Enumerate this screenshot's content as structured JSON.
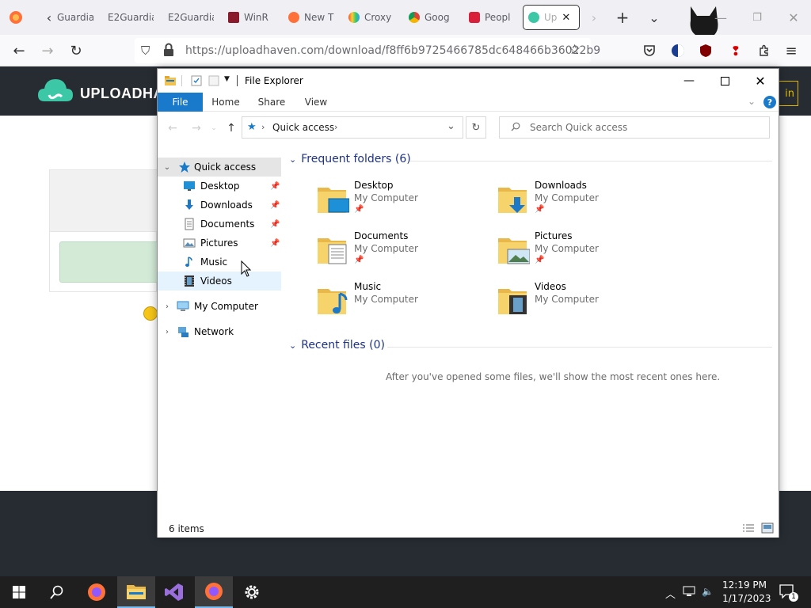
{
  "browser": {
    "tabs": [
      {
        "label": "Guardia",
        "icon": "chevron-left-icon"
      },
      {
        "label": "E2Guardia"
      },
      {
        "label": "E2Guardia"
      },
      {
        "label": "WinR",
        "icon": "winrar-icon"
      },
      {
        "label": "New T",
        "icon": "firefox-icon"
      },
      {
        "label": "Croxy",
        "icon": "rainbow-icon"
      },
      {
        "label": "Goog",
        "icon": "chrome-icon"
      },
      {
        "label": "Peopl",
        "icon": "lock-red-icon"
      },
      {
        "label": "Up",
        "icon": "uploadhaven-icon",
        "active": true
      }
    ],
    "url_host": "https://uploadhaven.com",
    "url_path": "/download/f8ff6b9725466785dc648466b36022b9"
  },
  "page": {
    "logo_text": "UPLOADHAVEN",
    "signin_peek": "in"
  },
  "explorer": {
    "title": "File Explorer",
    "ribbon_tabs": [
      "File",
      "Home",
      "Share",
      "View"
    ],
    "address": "Quick access",
    "search_placeholder": "Search Quick access",
    "nav": {
      "quick_access": "Quick access",
      "items": [
        {
          "label": "Desktop",
          "pinned": true
        },
        {
          "label": "Downloads",
          "pinned": true
        },
        {
          "label": "Documents",
          "pinned": true
        },
        {
          "label": "Pictures",
          "pinned": true
        },
        {
          "label": "Music",
          "pinned": false
        },
        {
          "label": "Videos",
          "pinned": false
        }
      ],
      "my_computer": "My Computer",
      "network": "Network"
    },
    "frequent_header": "Frequent folders (6)",
    "frequent": [
      {
        "name": "Desktop",
        "location": "My Computer",
        "pinned": true
      },
      {
        "name": "Downloads",
        "location": "My Computer",
        "pinned": true
      },
      {
        "name": "Documents",
        "location": "My Computer",
        "pinned": true
      },
      {
        "name": "Pictures",
        "location": "My Computer",
        "pinned": true
      },
      {
        "name": "Music",
        "location": "My Computer",
        "pinned": false
      },
      {
        "name": "Videos",
        "location": "My Computer",
        "pinned": false
      }
    ],
    "recent_header": "Recent files (0)",
    "recent_empty": "After you've opened some files, we'll show the most recent ones here.",
    "status": "6 items"
  },
  "taskbar": {
    "time": "12:19 PM",
    "date": "1/17/2023",
    "notification_count": "1"
  },
  "colors": {
    "accent": "#1979ca",
    "header_dark": "#272c33",
    "group_header": "#1e3287",
    "folder_yellow": "#f6d36b"
  }
}
